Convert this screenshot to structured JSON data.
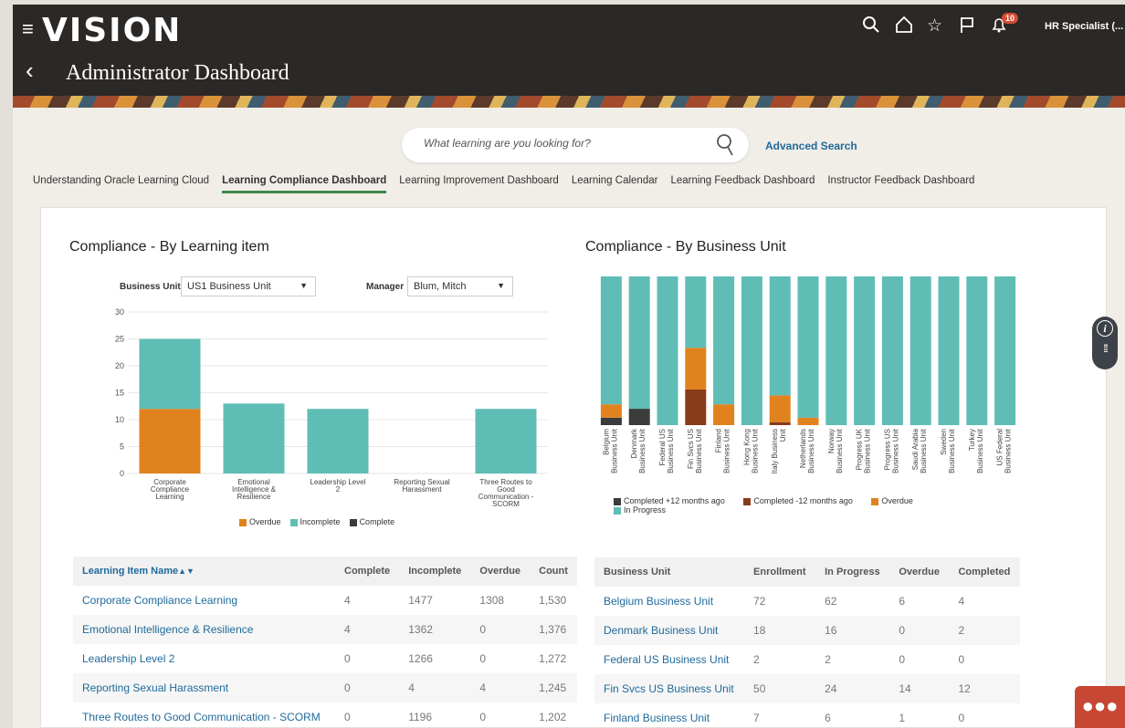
{
  "app": {
    "logo": "VISION",
    "page_title": "Administrator Dashboard",
    "user": "HR Specialist (... ∨",
    "notification_count": "10"
  },
  "search": {
    "placeholder": "What learning are you looking for?",
    "advanced": "Advanced Search"
  },
  "tabs": [
    {
      "label": "Understanding Oracle Learning Cloud",
      "active": false
    },
    {
      "label": "Learning Compliance Dashboard",
      "active": true
    },
    {
      "label": "Learning Improvement Dashboard",
      "active": false
    },
    {
      "label": "Learning Calendar",
      "active": false
    },
    {
      "label": "Learning Feedback Dashboard",
      "active": false
    },
    {
      "label": "Instructor Feedback Dashboard",
      "active": false
    }
  ],
  "left": {
    "title": "Compliance - By Learning item",
    "filters": {
      "bu_label": "Business Unit",
      "bu_value": "US1 Business Unit",
      "mgr_label": "Manager",
      "mgr_value": "Blum, Mitch"
    }
  },
  "right": {
    "title": "Compliance - By Business Unit"
  },
  "colors": {
    "overdue": "#e0821e",
    "incomplete": "#5fbdb6",
    "complete": "#3b3b3b",
    "completed_old": "#3b3b3b",
    "completed_recent": "#8a3b1a",
    "in_progress": "#5fbdb6"
  },
  "chart_data": [
    {
      "type": "bar",
      "stacked": true,
      "categories": [
        "Corporate Compliance Learning",
        "Emotional Intelligence & Resilience",
        "Leadership Level 2",
        "Reporting Sexual Harassment",
        "Three Routes to Good Communication - SCORM"
      ],
      "category_lines": [
        [
          "Corporate",
          "Compliance",
          "Learning"
        ],
        [
          "Emotional",
          "Intelligence &",
          "Resilience"
        ],
        [
          "Leadership Level",
          "2"
        ],
        [
          "Reporting Sexual",
          "Harassment"
        ],
        [
          "Three Routes to",
          "Good",
          "Communication -",
          "SCORM"
        ]
      ],
      "series": [
        {
          "name": "Overdue",
          "values": [
            12,
            0,
            0,
            0,
            0
          ]
        },
        {
          "name": "Incomplete",
          "values": [
            13,
            13,
            12,
            0,
            12
          ]
        },
        {
          "name": "Complete",
          "values": [
            0,
            0,
            0,
            0,
            0
          ]
        }
      ],
      "ylim": [
        0,
        30
      ],
      "yticks": [
        0,
        5,
        10,
        15,
        20,
        25,
        30
      ],
      "grid": true,
      "legend": "bottom"
    },
    {
      "type": "bar",
      "stacked": true,
      "percent": true,
      "categories": [
        "Belgium Business Unit",
        "Denmark Business Unit",
        "Federal US Business Unit",
        "Fin Svcs US Business Unit",
        "Finland Business Unit",
        "Hong Kong Business Unit",
        "Italy Business Unit",
        "Netherlands Business Unit",
        "Norway Business Unit",
        "Progress UK Business Unit",
        "Progress US Business Unit",
        "Saudi Arabia Business Unit",
        "Sweden Business Unit",
        "Turkey Business Unit",
        "US Federal Business Unit"
      ],
      "category_lines": [
        [
          "Belgium",
          "Business Unit"
        ],
        [
          "Denmark",
          "Business Unit"
        ],
        [
          "Federal US",
          "Business Unit"
        ],
        [
          "Fin Svcs US",
          "Business Unit"
        ],
        [
          "Finland",
          "Business Unit"
        ],
        [
          "Hong Kong",
          "Business Unit"
        ],
        [
          "Italy Business",
          "Unit"
        ],
        [
          "Netherlands",
          "Business Unit"
        ],
        [
          "Norway",
          "Business Unit"
        ],
        [
          "Progress UK",
          "Business Unit"
        ],
        [
          "Progress US",
          "Business Unit"
        ],
        [
          "Saudi Arabia",
          "Business Unit"
        ],
        [
          "Sweden",
          "Business Unit"
        ],
        [
          "Turkey",
          "Business Unit"
        ],
        [
          "US Federal",
          "Business Unit"
        ]
      ],
      "series": [
        {
          "name": "Completed +12 months ago",
          "values": [
            5,
            11,
            0,
            0,
            0,
            0,
            0,
            0,
            0,
            0,
            0,
            0,
            0,
            0,
            0
          ]
        },
        {
          "name": "Completed -12 months ago",
          "values": [
            0,
            0,
            0,
            24,
            0,
            0,
            2,
            0,
            0,
            0,
            0,
            0,
            0,
            0,
            0
          ]
        },
        {
          "name": "Overdue",
          "values": [
            9,
            0,
            0,
            28,
            14,
            0,
            18,
            5,
            0,
            0,
            0,
            0,
            0,
            0,
            0
          ]
        },
        {
          "name": "In Progress",
          "values": [
            86,
            89,
            100,
            48,
            86,
            100,
            80,
            95,
            100,
            100,
            100,
            100,
            100,
            100,
            100
          ]
        }
      ],
      "ylim": [
        0,
        100
      ],
      "legend": "bottom"
    }
  ],
  "learning_table": {
    "headers": [
      "Learning Item Name",
      "Complete",
      "Incomplete",
      "Overdue",
      "Count"
    ],
    "rows": [
      [
        "Corporate Compliance Learning",
        "4",
        "1477",
        "1308",
        "1,530"
      ],
      [
        "Emotional Intelligence & Resilience",
        "4",
        "1362",
        "0",
        "1,376"
      ],
      [
        "Leadership Level 2",
        "0",
        "1266",
        "0",
        "1,272"
      ],
      [
        "Reporting Sexual Harassment",
        "0",
        "4",
        "4",
        "1,245"
      ],
      [
        "Three Routes to Good Communication - SCORM",
        "0",
        "1196",
        "0",
        "1,202"
      ]
    ]
  },
  "bu_table": {
    "headers": [
      "Business Unit",
      "Enrollment",
      "In Progress",
      "Overdue",
      "Completed"
    ],
    "rows": [
      [
        "Belgium Business Unit",
        "72",
        "62",
        "6",
        "4"
      ],
      [
        "Denmark Business Unit",
        "18",
        "16",
        "0",
        "2"
      ],
      [
        "Federal US Business Unit",
        "2",
        "2",
        "0",
        "0"
      ],
      [
        "Fin Svcs US Business Unit",
        "50",
        "24",
        "14",
        "12"
      ],
      [
        "Finland Business Unit",
        "7",
        "6",
        "1",
        "0"
      ]
    ]
  }
}
